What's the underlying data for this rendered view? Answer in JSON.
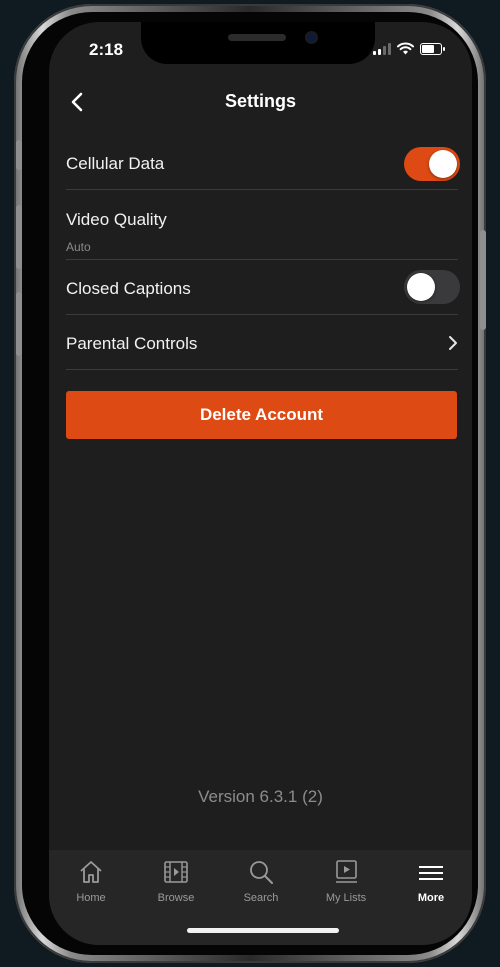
{
  "status_bar": {
    "time": "2:18"
  },
  "header": {
    "title": "Settings"
  },
  "settings": {
    "cellular_data": {
      "label": "Cellular Data",
      "enabled": true
    },
    "video_quality": {
      "label": "Video Quality",
      "value": "Auto"
    },
    "closed_captions": {
      "label": "Closed Captions",
      "enabled": false
    },
    "parental_controls": {
      "label": "Parental Controls"
    }
  },
  "delete_account": {
    "label": "Delete Account"
  },
  "version": {
    "text": "Version 6.3.1 (2)"
  },
  "tab_bar": {
    "items": [
      {
        "label": "Home",
        "icon": "home-icon",
        "active": false
      },
      {
        "label": "Browse",
        "icon": "film-icon",
        "active": false
      },
      {
        "label": "Search",
        "icon": "search-icon",
        "active": false
      },
      {
        "label": "My Lists",
        "icon": "playlist-icon",
        "active": false
      },
      {
        "label": "More",
        "icon": "menu-icon",
        "active": true
      }
    ]
  },
  "colors": {
    "accent": "#de4a14",
    "background": "#1e1e1e",
    "tab_bar": "#262626",
    "divider": "#3b3b3b",
    "toggle_off": "#3a3a3c"
  }
}
